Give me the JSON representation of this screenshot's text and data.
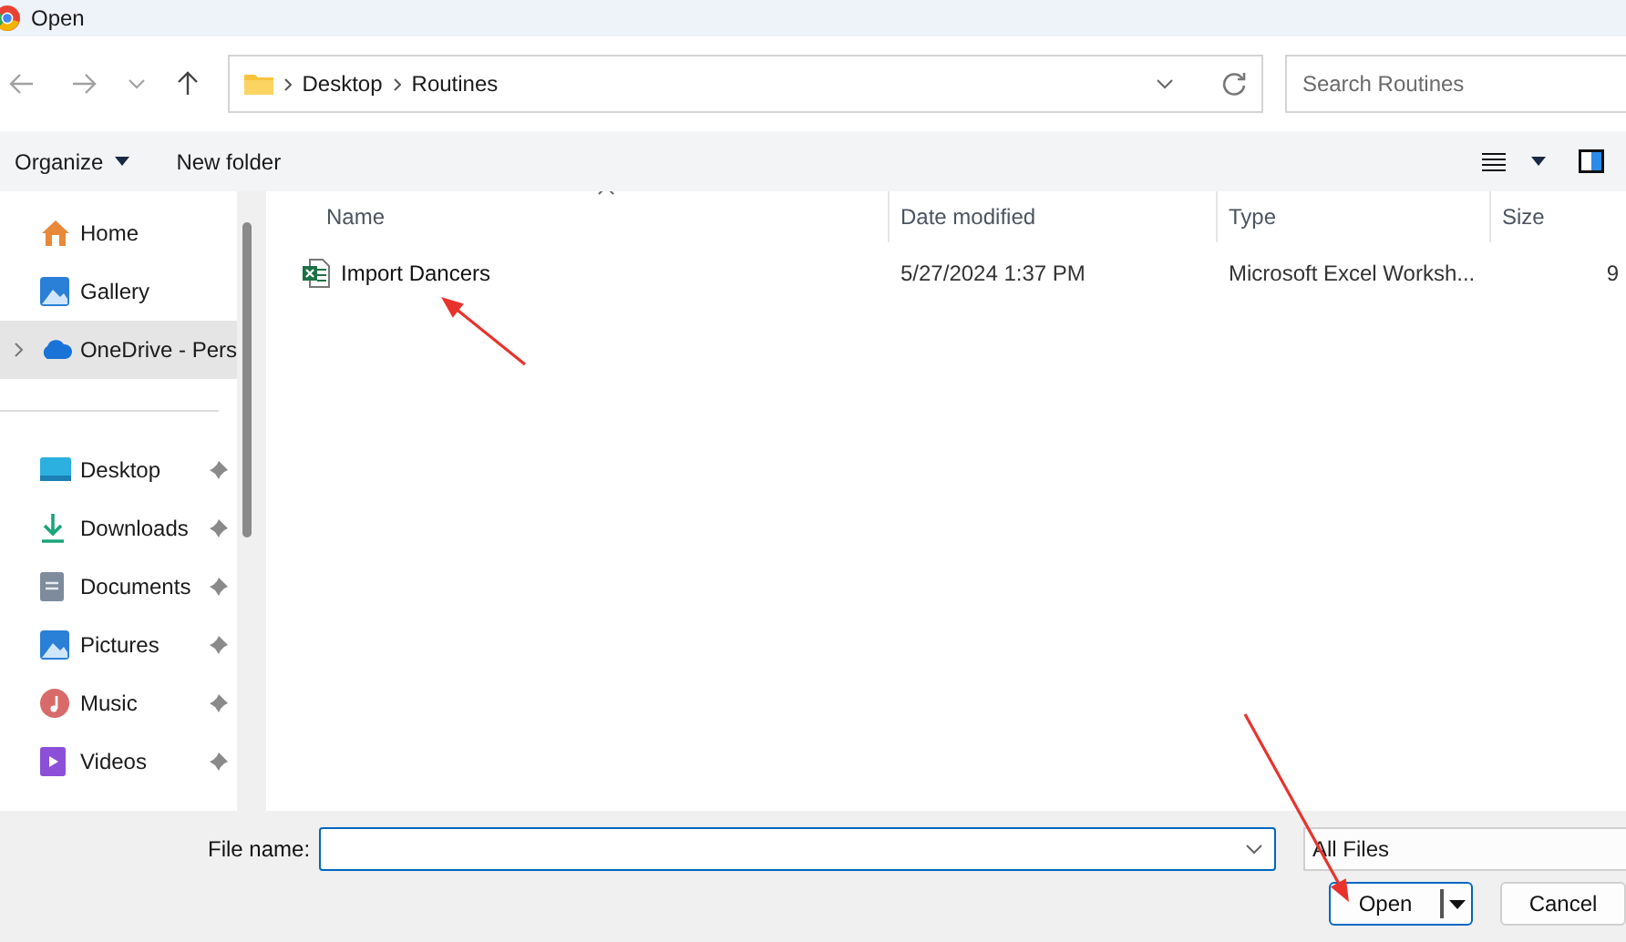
{
  "window": {
    "title": "Open"
  },
  "nav": {
    "breadcrumb": [
      "Desktop",
      "Routines"
    ],
    "search": {
      "placeholder": "Search Routines"
    }
  },
  "toolbar": {
    "organize": "Organize",
    "new_folder": "New folder"
  },
  "sidebar": {
    "items": [
      {
        "label": "Home",
        "kind": "home",
        "selected": false,
        "pinned": false,
        "expandable": false
      },
      {
        "label": "Gallery",
        "kind": "gallery",
        "selected": false,
        "pinned": false,
        "expandable": false
      },
      {
        "label": "OneDrive - Pers",
        "kind": "cloud",
        "selected": true,
        "pinned": false,
        "expandable": true
      },
      {
        "label": "Desktop",
        "kind": "desktop",
        "selected": false,
        "pinned": true,
        "expandable": false
      },
      {
        "label": "Downloads",
        "kind": "downloads",
        "selected": false,
        "pinned": true,
        "expandable": false
      },
      {
        "label": "Documents",
        "kind": "documents",
        "selected": false,
        "pinned": true,
        "expandable": false
      },
      {
        "label": "Pictures",
        "kind": "pictures",
        "selected": false,
        "pinned": true,
        "expandable": false
      },
      {
        "label": "Music",
        "kind": "music",
        "selected": false,
        "pinned": true,
        "expandable": false
      },
      {
        "label": "Videos",
        "kind": "videos",
        "selected": false,
        "pinned": true,
        "expandable": false
      }
    ]
  },
  "table": {
    "columns": [
      {
        "label": "Name",
        "sorted": true
      },
      {
        "label": "Date modified",
        "sorted": false
      },
      {
        "label": "Type",
        "sorted": false
      },
      {
        "label": "Size",
        "sorted": false
      }
    ],
    "rows": [
      {
        "name": "Import Dancers",
        "kind": "excel",
        "date_modified": "5/27/2024 1:37 PM",
        "type": "Microsoft Excel Worksh...",
        "size": "9"
      }
    ]
  },
  "footer": {
    "file_name_label": "File name:",
    "file_type": "All Files",
    "buttons": [
      {
        "label": "Open",
        "kind": "split"
      },
      {
        "label": "Cancel",
        "kind": "plain"
      }
    ]
  },
  "annotations": [
    {
      "kind": "arrow"
    },
    {
      "kind": "arrow"
    }
  ]
}
